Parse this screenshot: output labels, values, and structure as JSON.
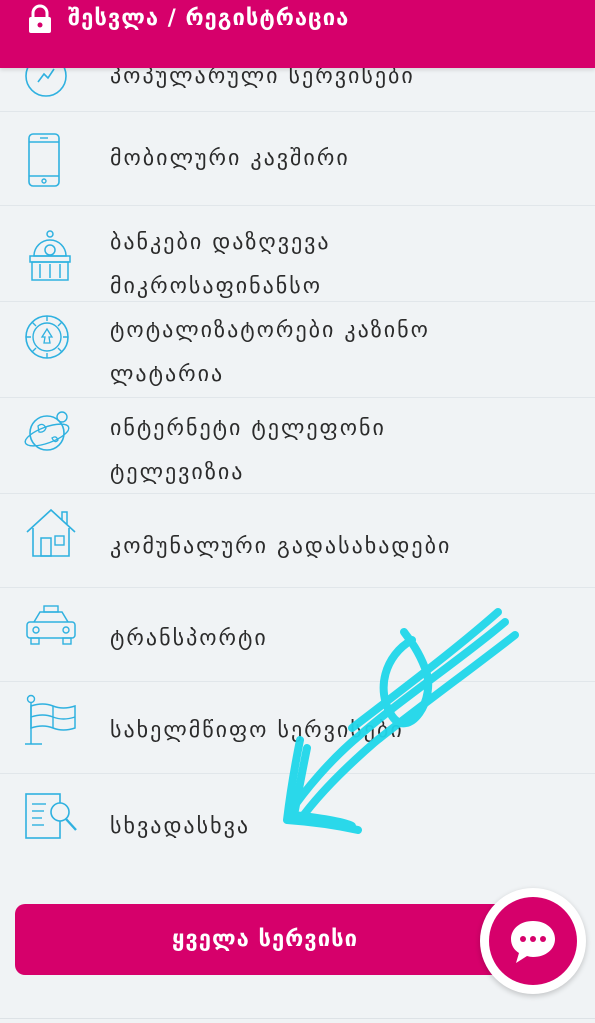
{
  "header": {
    "title": "შესვლა / რეგისტრაცია",
    "icon": "lock-icon",
    "background": "#d6006b"
  },
  "categories": [
    {
      "lines": [
        "პოპულარული სერვისები"
      ],
      "icon": "popular-services-icon"
    },
    {
      "lines": [
        "მობილური კავშირი"
      ],
      "icon": "mobile-phone-icon"
    },
    {
      "lines": [
        "ბანკები დაზღვევა",
        "მიკროსაფინანსო"
      ],
      "icon": "bank-icon"
    },
    {
      "lines": [
        "ტოტალიზატორები კაზინო",
        "ლატარია"
      ],
      "icon": "casino-chip-icon"
    },
    {
      "lines": [
        "ინტერნეტი ტელეფონი",
        "ტელევიზია"
      ],
      "icon": "globe-icon"
    },
    {
      "lines": [
        "კომუნალური გადასახადები"
      ],
      "icon": "house-icon"
    },
    {
      "lines": [
        "ტრანსპორტი"
      ],
      "icon": "taxi-icon"
    },
    {
      "lines": [
        "სახელმწიფო სერვისები"
      ],
      "icon": "government-flag-icon"
    },
    {
      "lines": [
        "სხვადასხვა"
      ],
      "icon": "document-search-icon"
    }
  ],
  "all_services_button": {
    "label": "ყველა სერვისი"
  },
  "chat_button": {
    "icon": "chat-bubble-icon"
  },
  "colors": {
    "accent": "#d6006b",
    "icon": "#2fb1e0",
    "annotation": "#20d7ea"
  }
}
